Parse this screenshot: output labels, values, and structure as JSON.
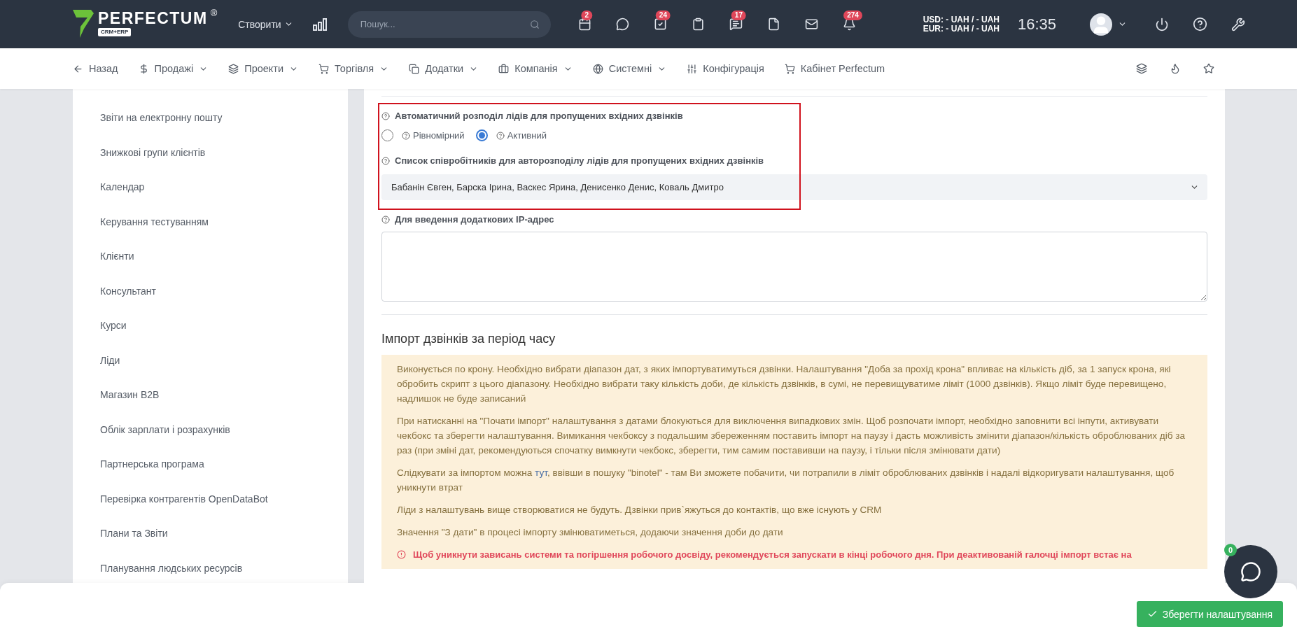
{
  "topbar": {
    "logo": {
      "name": "PERFECTUM",
      "mark": "®",
      "tag": "CRM+ERP"
    },
    "create": {
      "label": "Створити"
    },
    "search": {
      "placeholder": "Пошук..."
    },
    "badges": [
      "2",
      "24",
      "17",
      "274"
    ],
    "currency": [
      "USD: - UAH / - UAH",
      "EUR: - UAH / - UAH"
    ],
    "time": "16:35"
  },
  "nav": {
    "items": [
      {
        "label": "Назад",
        "dropdown": false
      },
      {
        "label": "Продажі",
        "dropdown": true
      },
      {
        "label": "Проекти",
        "dropdown": true
      },
      {
        "label": "Торгівля",
        "dropdown": true
      },
      {
        "label": "Додатки",
        "dropdown": true
      },
      {
        "label": "Компанія",
        "dropdown": true
      },
      {
        "label": "Системні",
        "dropdown": true
      },
      {
        "label": "Конфігурація",
        "dropdown": false
      },
      {
        "label": "Кабінет Perfectum",
        "dropdown": false
      }
    ]
  },
  "sidebar": {
    "items": [
      {
        "label": "Звіти на електронну пошту"
      },
      {
        "label": "Знижкові групи клієнтів"
      },
      {
        "label": "Календар"
      },
      {
        "label": "Керування тестуванням"
      },
      {
        "label": "Клієнти"
      },
      {
        "label": "Консультант"
      },
      {
        "label": "Курси"
      },
      {
        "label": "Ліди"
      },
      {
        "label": "Магазин B2B"
      },
      {
        "label": "Облік зарплати і розрахунків"
      },
      {
        "label": "Партнерська програма"
      },
      {
        "label": "Перевірка контрагентів OpenDataBot"
      },
      {
        "label": "Плани та Звіти"
      },
      {
        "label": "Планування людських ресурсів"
      }
    ]
  },
  "form": {
    "distribution": {
      "label": "Автоматичний розподіл лідів для пропущених вхідних дзвінків",
      "options": [
        {
          "label": "Рівномірний",
          "selected": false
        },
        {
          "label": "Активний",
          "selected": true
        }
      ]
    },
    "employees": {
      "label": "Список співробітників для авторозподілу лідів для пропущених вхідних дзвінків",
      "value": "Бабанін Євген, Барска Ірина, Васкес Ярина, Денисенко Денис, Коваль Дмитро"
    },
    "ip": {
      "label": "Для введення додаткових IP-адрес"
    }
  },
  "import": {
    "title": "Імпорт дзвінків за період часу",
    "paragraphs": [
      {
        "kind": "text",
        "text": "Виконується по крону. Необхідно вибрати діапазон дат, з яких імпортуватимуться дзвінки. Налаштування \"Доба за прохід крона\" впливає на кількість діб, за 1 запуск крона, які обробить скрипт з цього діапазону. Необхідно вибрати таку кількість доби, де кількість дзвінків, в сумі, не перевищуватиме ліміт (1000 дзвінків). Якщо ліміт буде перевищено, надлишок не буде записаний"
      },
      {
        "kind": "text",
        "text": "При натисканні на \"Почати імпорт\" налаштування з датами блокуються для виключення випадкових змін. Щоб розпочати імпорт, необхідно заповнити всі інпути, активувати чекбокс та зберегти налаштування. Вимикання чекбоксу з подальшим збереженням поставить імпорт на паузу і дасть можливість змінити діапазон/кількість оброблюваних діб за раз (при зміні дат, рекомендуються спочатку вимкнути чекбокс, зберегти, тим самим поставивши на паузу, і тільки після змінювати дати)"
      },
      {
        "kind": "link",
        "before": "Слідкувати за імпортом можна ",
        "link": "тут",
        "after": ", ввівши в пошуку \"binotel\" - там Ви зможете побачити, чи потрапили в ліміт оброблюваних дзвінків і надалі відкоригувати налаштування, щоб уникнути втрат"
      },
      {
        "kind": "text",
        "text": "Ліди з налаштувань вище створюватися не будуть. Дзвінки прив`яжуться до контактів, що вже існують у CRM"
      },
      {
        "kind": "text",
        "text": "Значення \"З дати\" в процесі імпорту змінюватиметься, додаючи значення доби до дати"
      },
      {
        "kind": "warning",
        "text": "Щоб уникнути зависань системи та погіршення робочого досвіду, рекомендується запускати в кінці робочого дня. При деактивованій галочці імпорт встає на"
      }
    ]
  },
  "footer": {
    "save": "Зберегти налаштування"
  },
  "chat": {
    "badge": "0"
  }
}
